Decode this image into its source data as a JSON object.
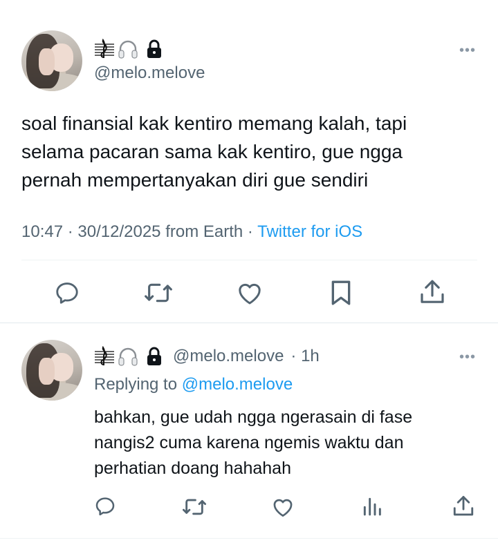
{
  "main_tweet": {
    "display_name_icons": [
      "music-score-icon",
      "headphones-icon",
      "lock-icon"
    ],
    "handle": "@melo.melove",
    "more_label": "•••",
    "text_lines": [
      "soal finansial kak kentiro memang kalah, tapi",
      "selama pacaran sama kak kentiro, gue ngga",
      "pernah mempertanyakan diri gue sendiri"
    ],
    "time": "10:47",
    "separator": "·",
    "date": "30/12/2025",
    "location": "from Earth",
    "client": "Twitter for iOS",
    "actions": [
      "reply-icon",
      "retweet-icon",
      "like-icon",
      "bookmark-icon",
      "share-icon"
    ]
  },
  "reply_tweet": {
    "display_name_icons": [
      "music-score-icon",
      "headphones-icon",
      "lock-icon"
    ],
    "handle": "@melo.melove",
    "time_ago": "· 1h",
    "more_label": "•••",
    "replying_to_label": "Replying to",
    "replying_to_handle": "@melo.melove",
    "text_lines": [
      "bahkan, gue udah ngga ngerasain di fase",
      "nangis2 cuma karena ngemis waktu dan",
      "perhatian doang hahahah"
    ],
    "actions": [
      "reply-icon",
      "retweet-icon",
      "like-icon",
      "views-icon",
      "share-icon"
    ]
  },
  "colors": {
    "text": "#0f1419",
    "secondary": "#536471",
    "link": "#1d9bf0",
    "icon": "#536471",
    "divider": "#eff3f4"
  }
}
